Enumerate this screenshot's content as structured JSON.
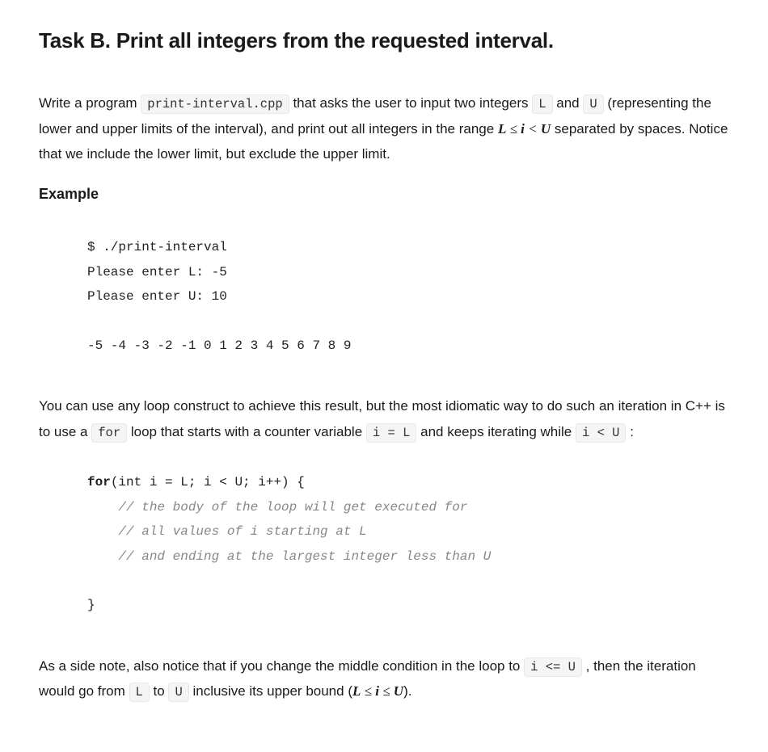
{
  "title": "Task B. Print all integers from the requested interval.",
  "intro": {
    "part1": "Write a program ",
    "code_filename": "print-interval.cpp",
    "part2": " that asks the user to input two integers ",
    "code_L": "L",
    "part3": " and ",
    "code_U": "U",
    "part4": " (representing the lower and upper limits of the interval), and print out all integers in the range ",
    "range_expr_html": "L ≤ i < U",
    "part5": " separated by spaces. Notice that we include the lower limit, but exclude the upper limit."
  },
  "example_heading": "Example",
  "example_output": "$ ./print-interval\nPlease enter L: -5\nPlease enter U: 10\n\n-5 -4 -3 -2 -1 0 1 2 3 4 5 6 7 8 9",
  "para2": {
    "part1": "You can use any loop construct to achieve this result, but the most idiomatic way to do such an iteration in C++ is to use a ",
    "code_for": "for",
    "part2": " loop that starts with a counter variable ",
    "code_i_eq_L": "i = L",
    "part3": " and keeps iterating while ",
    "code_i_lt_U": "i < U",
    "part4": " :"
  },
  "loop_code": {
    "kw_for": "for",
    "sig_rest": "(int i = L; i < U; i++) {",
    "c1": "// the body of the loop will get executed for",
    "c2": "// all values of i starting at L",
    "c3": "// and ending at the largest integer less than U",
    "close": "}"
  },
  "para3": {
    "part1": "As a side note, also notice that if you change the middle condition in the loop to ",
    "code_i_le_U": "i <= U",
    "part2": " , then the iteration would go from ",
    "code_L": "L",
    "part3": " to ",
    "code_U": "U",
    "part4": " inclusive its upper bound (",
    "range_expr2": "L ≤ i ≤ U",
    "part5": ")."
  }
}
